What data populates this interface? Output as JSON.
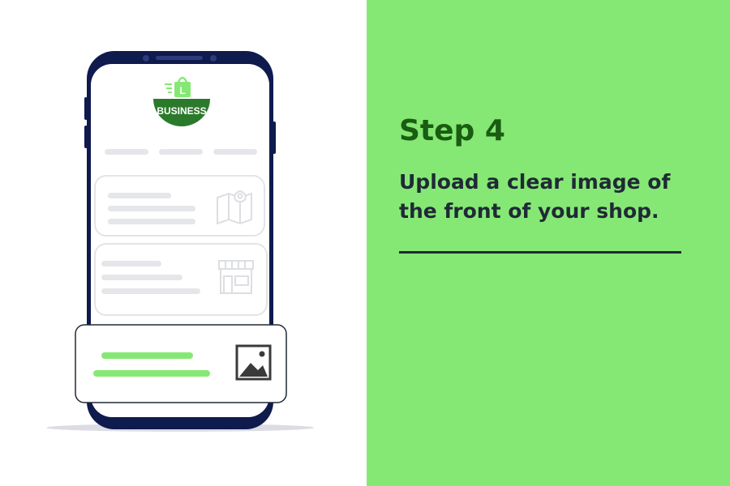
{
  "colors": {
    "panel_bg": "#86e874",
    "title_color": "#1a5c12",
    "text_color": "#1f2a36",
    "logo_green": "#2b7a2b",
    "phone_frame": "#0f1a4d",
    "bar_green": "#86e874"
  },
  "logo": {
    "label": "BUSINESS"
  },
  "step": {
    "title": "Step 4",
    "description": "Upload a clear image of the front of your shop."
  },
  "icons": {
    "map": "map-pin-icon",
    "shop": "storefront-icon",
    "image": "image-icon",
    "bag": "shopping-bag-icon"
  }
}
